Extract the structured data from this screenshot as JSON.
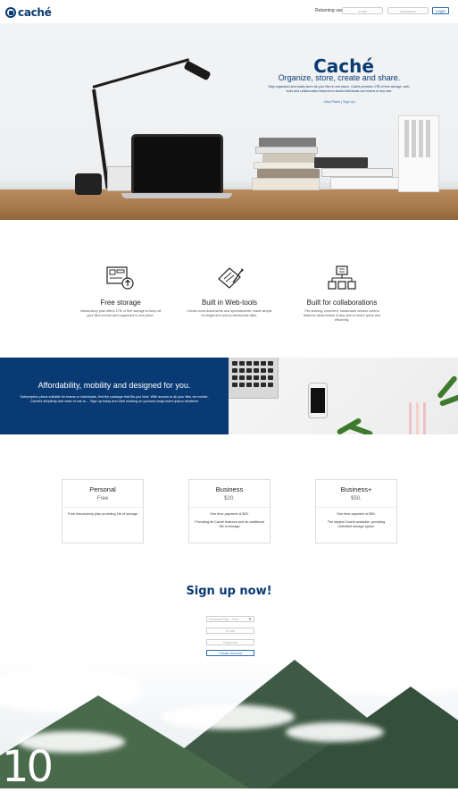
{
  "header": {
    "logo_text": "caché",
    "returning_label": "Returning user:",
    "email_placeholder": "email",
    "password_placeholder": "password",
    "login_label": "Login"
  },
  "hero": {
    "title": "Caché",
    "subtitle": "Organize, store, create and share.",
    "description": "Stay organized and easily store all your files in one place. Caché provides 1TB of free storage, web-tools and collaboration features to assist individuals and teams of any size.",
    "links": "View Plans | Sign Up"
  },
  "features": [
    {
      "icon": "storage-icon",
      "title": "Free storage",
      "text": "Introductory plan offers 1TB of free storage to keep all your files secure and organized in one place."
    },
    {
      "icon": "web-tools-icon",
      "title": "Built in Web-tools",
      "text": "Create word documents and spreadsheets, made simple for beginners and professionals alike."
    },
    {
      "icon": "collaboration-icon",
      "title": "Built for collaborations",
      "text": "File sharing, comment, moderated version control features allow teams of any size to share quick and efficiently."
    }
  ],
  "afford": {
    "title": "Affordability, mobility and designed for you.",
    "text": "Subscription plans suitable for teams or individuals, find the package that fits you best. With access to all your files via mobile, Caché's simplicity and ease of use is....   Sign up today and start working on youruorrunoja lorem ipsmu whatever"
  },
  "plans": [
    {
      "name": "Personal",
      "price": "Free",
      "line1": "Free introductory plan providing 1tb of storage",
      "line2": ""
    },
    {
      "name": "Business",
      "price": "$20.",
      "line1": "One time payment of $20.",
      "line2": "Providing all Caché features and an additional 2tb of storage"
    },
    {
      "name": "Business+",
      "price": "$50.",
      "line1": "One time payment of $50.",
      "line2": "The largest Caché available, providing Unlimited storage space."
    }
  ],
  "signup": {
    "title": "Sign up now!",
    "select_value": "Personal Plan - Free",
    "email_placeholder": "E-mail",
    "password_placeholder": "Password",
    "button_label": "Create Account"
  },
  "footer": {
    "big_number": "10"
  },
  "colors": {
    "brand": "#0a3a74",
    "link": "#2b6cb0"
  }
}
